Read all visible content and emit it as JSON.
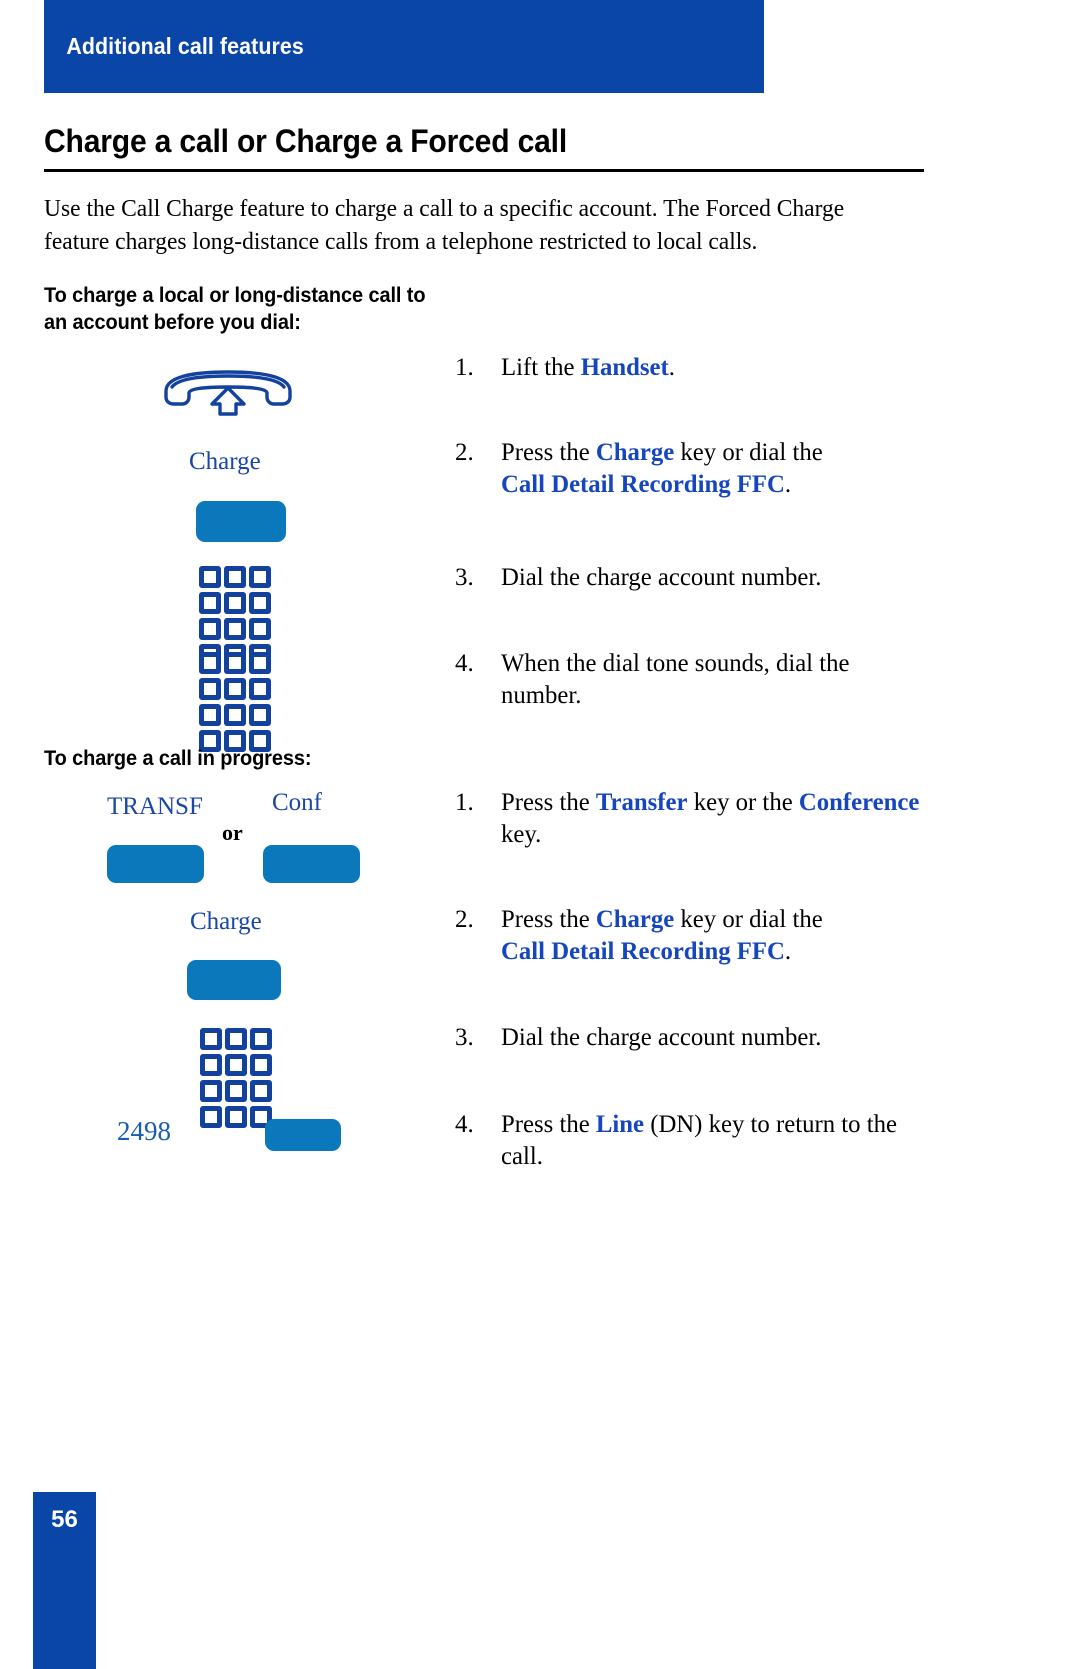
{
  "header": {
    "banner_title": "Additional call features",
    "banner_color": "#0a45a8"
  },
  "page_title": "Charge a call or Charge a Forced call",
  "intro_paragraph": "Use the Call Charge feature to charge a call to a specific account. The Forced Charge feature charges long-distance calls from a telephone restricted to local calls.",
  "sections": [
    {
      "heading": "To charge a local or long-distance call to an account before you dial:",
      "icons": [
        {
          "type": "handset-icon",
          "label": ""
        },
        {
          "type": "key",
          "label": "Charge"
        },
        {
          "type": "keypad-icon",
          "label": ""
        },
        {
          "type": "keypad-icon",
          "label": ""
        }
      ],
      "steps": [
        {
          "num": "1.",
          "parts": [
            {
              "text": "Lift the ",
              "style": "plain"
            },
            {
              "text": "Handset",
              "style": "keyword"
            },
            {
              "text": ".",
              "style": "plain"
            }
          ]
        },
        {
          "num": "2.",
          "parts": [
            {
              "text": "Press the ",
              "style": "plain"
            },
            {
              "text": "Charge",
              "style": "keyword"
            },
            {
              "text": " key or dial the ",
              "style": "plain"
            },
            {
              "text": "Call Detail Recording FFC",
              "style": "keyword"
            },
            {
              "text": ".",
              "style": "plain"
            }
          ]
        },
        {
          "num": "3.",
          "parts": [
            {
              "text": "Dial the charge account number.",
              "style": "plain"
            }
          ]
        },
        {
          "num": "4.",
          "parts": [
            {
              "text": "When the dial tone sounds, dial the number.",
              "style": "plain"
            }
          ]
        }
      ]
    },
    {
      "heading": "To charge a call in progress:",
      "icons": [
        {
          "type": "key",
          "label": "TRANSF"
        },
        {
          "type": "or",
          "label": "or"
        },
        {
          "type": "key",
          "label": "Conf"
        },
        {
          "type": "key",
          "label": "Charge"
        },
        {
          "type": "keypad-icon",
          "label": ""
        },
        {
          "type": "key",
          "label": "2498"
        }
      ],
      "steps": [
        {
          "num": "1.",
          "parts": [
            {
              "text": "Press the ",
              "style": "plain"
            },
            {
              "text": "Transfer",
              "style": "keyword"
            },
            {
              "text": " key or the ",
              "style": "plain"
            },
            {
              "text": "Conference",
              "style": "keyword"
            },
            {
              "text": " key.",
              "style": "plain"
            }
          ]
        },
        {
          "num": "2.",
          "parts": [
            {
              "text": "Press the ",
              "style": "plain"
            },
            {
              "text": "Charge",
              "style": "keyword"
            },
            {
              "text": " key or dial the ",
              "style": "plain"
            },
            {
              "text": "Call Detail Recording FFC",
              "style": "keyword"
            },
            {
              "text": ".",
              "style": "plain"
            }
          ]
        },
        {
          "num": "3.",
          "parts": [
            {
              "text": "Dial the charge account number.",
              "style": "plain"
            }
          ]
        },
        {
          "num": "4.",
          "parts": [
            {
              "text": "Press the ",
              "style": "plain"
            },
            {
              "text": "Line",
              "style": "keyword"
            },
            {
              "text": " (DN) key to return to the call.",
              "style": "plain"
            }
          ]
        }
      ]
    }
  ],
  "labels": {
    "charge_key_1": "Charge",
    "transfer_key": "TRANSF",
    "or": "or",
    "conference_key": "Conf",
    "charge_key_2": "Charge",
    "dn_number": "2498"
  },
  "footer": {
    "page_number": "56",
    "block_color": "#0a45a8"
  },
  "colors": {
    "banner_blue": "#0a45a8",
    "button_blue": "#0b78bb",
    "icon_blue": "#12419e",
    "label_blue": "#1a46a8",
    "keyword_blue": "#1546bd"
  }
}
